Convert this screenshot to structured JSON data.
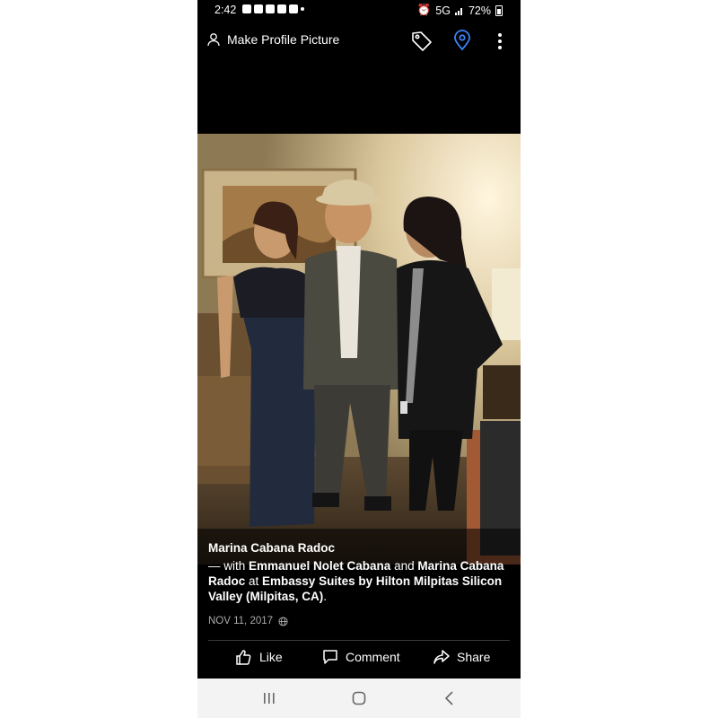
{
  "status_bar": {
    "time": "2:42",
    "network": "5G",
    "battery": "72%"
  },
  "top_bar": {
    "profile_label": "Make Profile Picture"
  },
  "post": {
    "author": "Marina Cabana Radoc",
    "with_prefix": "— with ",
    "tagged_1": "Emmanuel Nolet Cabana",
    "and_word": " and ",
    "tagged_2": "Marina Cabana Radoc",
    "at_word": " at ",
    "place": "Embassy Suites by Hilton Milpitas Silicon Valley (Milpitas, CA)",
    "end_punct": ".",
    "date": "NOV 11, 2017"
  },
  "actions": {
    "like": "Like",
    "comment": "Comment",
    "share": "Share"
  },
  "colors": {
    "location_icon": "#3b82f6",
    "nav_bar": "#f3f3f3"
  }
}
